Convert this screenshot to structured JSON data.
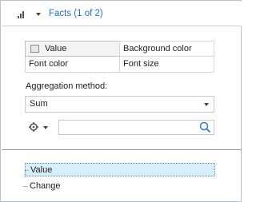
{
  "header": {
    "icon": "bar-chart-icon",
    "title": "Facts (1 of 2)"
  },
  "attributes": {
    "items": [
      {
        "label": "Value",
        "checked": false
      },
      {
        "label": "Background color"
      },
      {
        "label": "Font color"
      },
      {
        "label": "Font size"
      }
    ]
  },
  "aggregation": {
    "label": "Aggregation method:",
    "selected": "Sum"
  },
  "toolbar": {
    "gear_icon": "gear-icon",
    "search_icon": "search-icon",
    "search_value": ""
  },
  "facts_list": {
    "items": [
      {
        "label": "Value",
        "selected": true
      },
      {
        "label": "Change",
        "selected": false
      }
    ]
  },
  "colors": {
    "accent": "#1f6fbf",
    "selection": "#d9eefb"
  }
}
